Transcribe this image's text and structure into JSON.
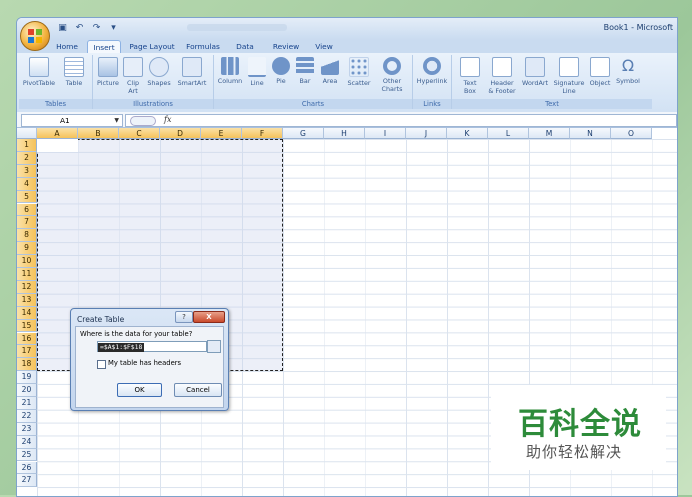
{
  "window": {
    "title": "Book1 - Microsoft"
  },
  "qat": {
    "icons": [
      "save-icon",
      "undo-icon",
      "redo-icon"
    ]
  },
  "tabs": [
    "Home",
    "Insert",
    "Page Layout",
    "Formulas",
    "Data",
    "Review",
    "View"
  ],
  "active_tab": "Insert",
  "ribbon": {
    "groups": [
      {
        "label": "Tables",
        "buttons": [
          "PivotTable",
          "Table"
        ]
      },
      {
        "label": "Illustrations",
        "buttons": [
          "Picture",
          "Clip\nArt",
          "Shapes",
          "SmartArt"
        ]
      },
      {
        "label": "Charts",
        "buttons": [
          "Column",
          "Line",
          "Pie",
          "Bar",
          "Area",
          "Scatter",
          "Other\nCharts"
        ]
      },
      {
        "label": "Links",
        "buttons": [
          "Hyperlink"
        ]
      },
      {
        "label": "Text",
        "buttons": [
          "Text\nBox",
          "Header\n& Footer",
          "WordArt",
          "Signature\nLine",
          "Object",
          "Symbol"
        ]
      }
    ]
  },
  "formula_bar": {
    "name_box": "A1",
    "fx": "fx",
    "content": ""
  },
  "columns": [
    "A",
    "B",
    "C",
    "D",
    "E",
    "F",
    "G",
    "H",
    "I",
    "J",
    "K",
    "L",
    "M",
    "N",
    "O"
  ],
  "selected_columns": [
    "A",
    "B",
    "C",
    "D",
    "E",
    "F"
  ],
  "rows": [
    "1",
    "2",
    "3",
    "4",
    "5",
    "6",
    "7",
    "8",
    "9",
    "10",
    "11",
    "12",
    "13",
    "14",
    "15",
    "16",
    "17",
    "18",
    "19",
    "20",
    "21",
    "22",
    "23",
    "24",
    "25",
    "26",
    "27"
  ],
  "selected_row_count": 18,
  "dialog": {
    "title": "Create Table",
    "help": "?",
    "close": "X",
    "question": "Where is the data for your table?",
    "range_value": "=$A$1:$F$18",
    "checkbox_label": "My table has headers",
    "checkbox_checked": false,
    "ok": "OK",
    "cancel": "Cancel"
  },
  "watermark": {
    "title": "百科全说",
    "subtitle": "助你轻松解决"
  }
}
